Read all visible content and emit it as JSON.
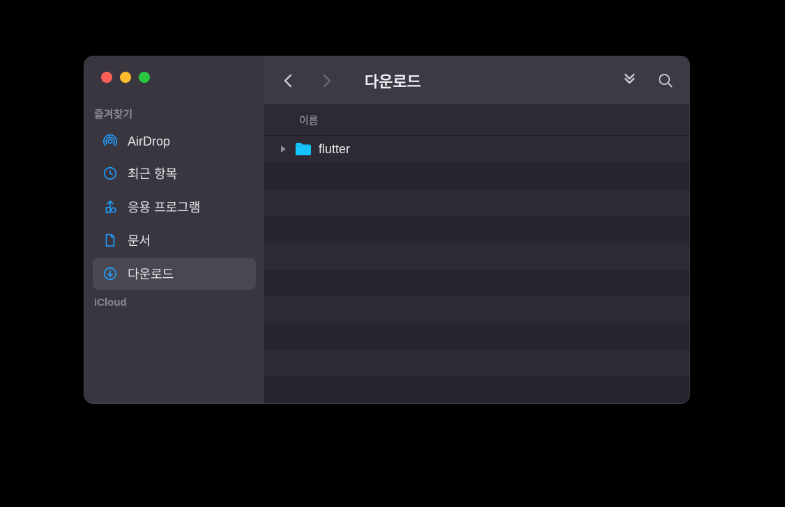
{
  "window": {
    "title": "다운로드"
  },
  "sidebar": {
    "sections": [
      {
        "label": "즐겨찾기",
        "items": [
          {
            "icon": "airdrop",
            "label": "AirDrop",
            "selected": false
          },
          {
            "icon": "clock",
            "label": "최근 항목",
            "selected": false
          },
          {
            "icon": "apps",
            "label": "응용 프로그램",
            "selected": false
          },
          {
            "icon": "document",
            "label": "문서",
            "selected": false
          },
          {
            "icon": "download",
            "label": "다운로드",
            "selected": true
          }
        ]
      },
      {
        "label": "iCloud",
        "items": []
      }
    ]
  },
  "list": {
    "header": {
      "name": "이름"
    },
    "items": [
      {
        "name": "flutter",
        "type": "folder",
        "expandable": true
      }
    ]
  },
  "colors": {
    "accent": "#1e9fff",
    "folder": "#16c3ff"
  }
}
